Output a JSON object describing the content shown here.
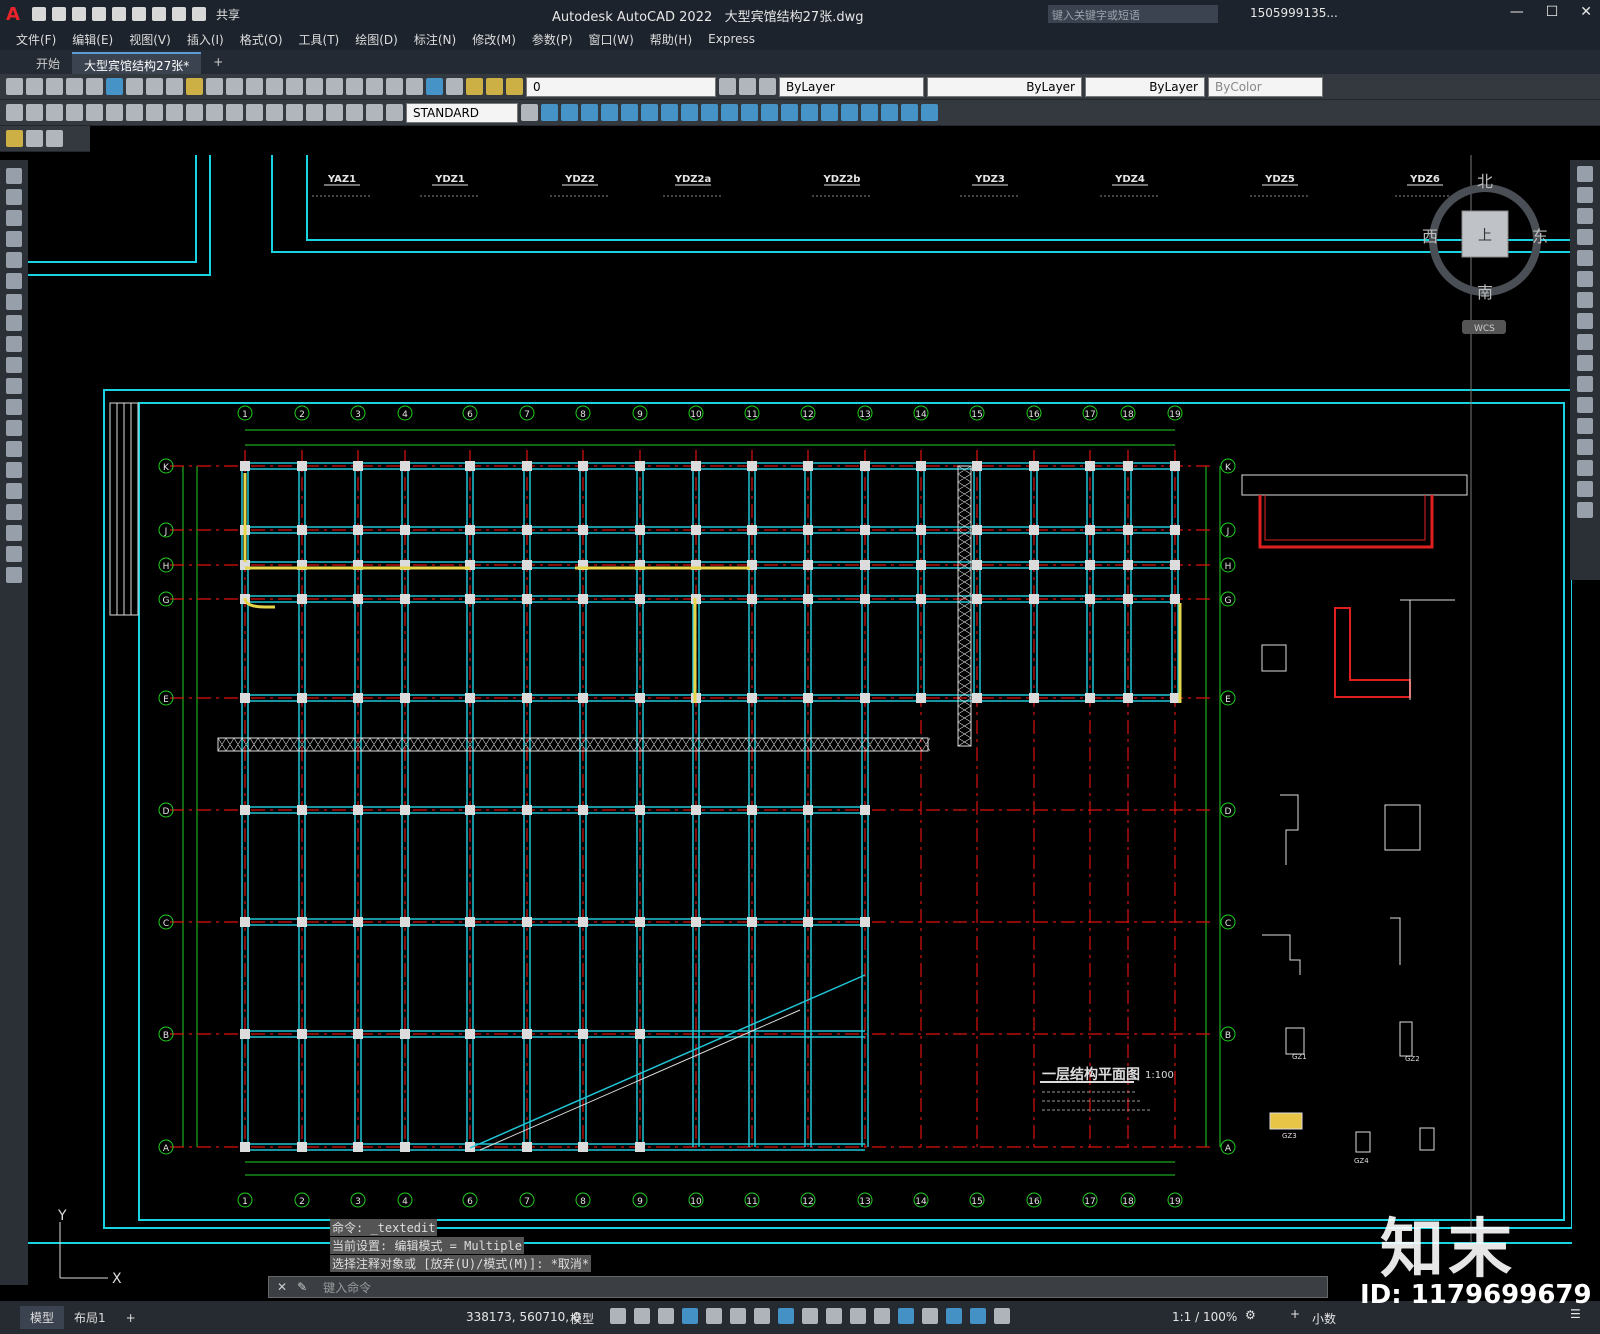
{
  "app": {
    "brand": "A",
    "title": "Autodesk AutoCAD 2022",
    "filename": "大型宾馆结构27张.dwg",
    "share": "共享",
    "search_placeholder": "键入关键字或短语",
    "user": "1505999135..."
  },
  "menu": [
    "文件(F)",
    "编辑(E)",
    "视图(V)",
    "插入(I)",
    "格式(O)",
    "工具(T)",
    "绘图(D)",
    "标注(N)",
    "修改(M)",
    "参数(P)",
    "窗口(W)",
    "帮助(H)",
    "Express"
  ],
  "tabs": [
    "开始",
    "大型宾馆结构27张*"
  ],
  "toolbar": {
    "layer": "0",
    "style": "STANDARD",
    "color": "ByLayer",
    "linetype": "ByLayer",
    "lineweight": "ByLayer",
    "plotstyle": "ByColor"
  },
  "viewcube": {
    "north": "北",
    "south": "南",
    "east": "东",
    "west": "西",
    "top": "上",
    "wcs": "WCS"
  },
  "drawing": {
    "title": "一层结构平面图",
    "scale": "1:100",
    "col_labels": [
      "1",
      "2",
      "3",
      "4",
      "6",
      "7",
      "8",
      "9",
      "10",
      "11",
      "12",
      "13",
      "14",
      "15",
      "16",
      "17",
      "18",
      "19"
    ],
    "row_labels": [
      "K",
      "J",
      "H",
      "G",
      "E",
      "D",
      "C",
      "B",
      "A"
    ],
    "top_labels": [
      "YAZ1",
      "YDZ1",
      "YDZ2",
      "YDZ2a",
      "YDZ2b",
      "YDZ3",
      "YDZ4",
      "YDZ5",
      "YDZ6"
    ],
    "detail_labels": [
      "GZ1",
      "GZ2",
      "GZ3",
      "GZ4"
    ]
  },
  "command": {
    "history": [
      "命令: _textedit",
      "当前设置: 编辑模式 = Multiple",
      "选择注释对象或 [放弃(U)/模式(M)]: *取消*"
    ],
    "placeholder": "键入命令"
  },
  "status": {
    "tabs": [
      "模型",
      "布局1"
    ],
    "coords": "338173, 560710, 0",
    "mode": "模型",
    "zoom": "1:1 / 100%",
    "unit": "小数"
  },
  "watermark": {
    "brand": "知末",
    "id": "ID: 1179699679"
  }
}
